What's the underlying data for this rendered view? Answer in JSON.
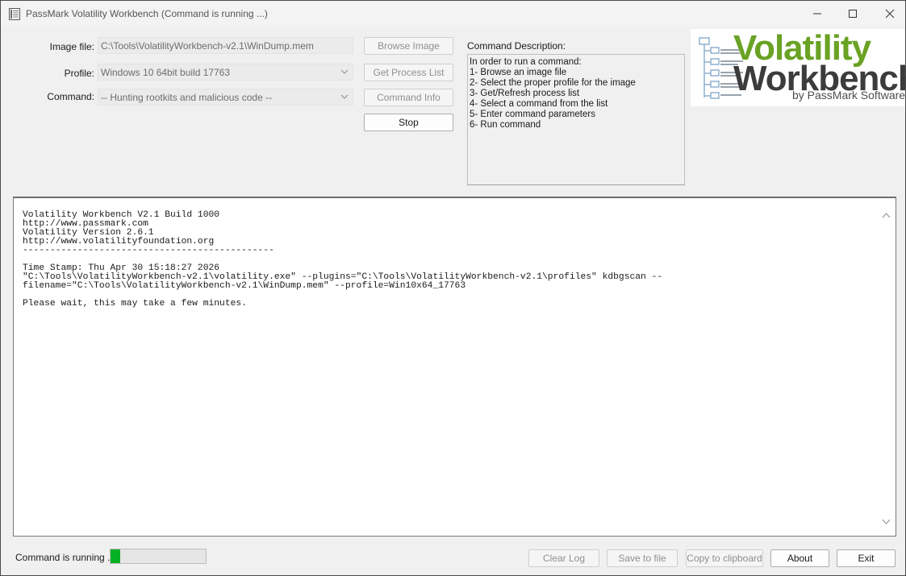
{
  "window": {
    "title": "PassMark Volatility Workbench (Command is running ...)"
  },
  "form": {
    "image_file_label": "Image file:",
    "image_file_value": "C:\\Tools\\VolatilityWorkbench-v2.1\\WinDump.mem",
    "profile_label": "Profile:",
    "profile_value": "Windows 10 64bit build 17763",
    "command_label": "Command:",
    "command_value": "-- Hunting rootkits and malicious code --"
  },
  "buttons": {
    "browse_image": "Browse Image",
    "get_process_list": "Get Process List",
    "command_info": "Command Info",
    "stop": "Stop"
  },
  "command_description": {
    "label": "Command Description:",
    "lines": [
      "In order to run a command:",
      "1- Browse an image file",
      "2- Select the proper profile for the image",
      "3- Get/Refresh process list",
      "4- Select a command from the list",
      "5- Enter command parameters",
      "6- Run command"
    ]
  },
  "logo": {
    "line1": "Volatility",
    "line2": "Workbench",
    "byline": "by PassMark Software"
  },
  "log": {
    "lines": [
      "Volatility Workbench V2.1 Build 1000",
      "http://www.passmark.com",
      "Volatility Version 2.6.1",
      "http://www.volatilityfoundation.org",
      "----------------------------------------------",
      "",
      "Time Stamp: Thu Apr 30 15:18:27 2026",
      "\"C:\\Tools\\VolatilityWorkbench-v2.1\\volatility.exe\" --plugins=\"C:\\Tools\\VolatilityWorkbench-v2.1\\profiles\" kdbgscan --",
      "filename=\"C:\\Tools\\VolatilityWorkbench-v2.1\\WinDump.mem\" --profile=Win10x64_17763",
      "",
      "Please wait, this may take a few minutes."
    ]
  },
  "status": {
    "text": "Command is running ...",
    "progress": 0.1
  },
  "footer_buttons": {
    "clear_log": "Clear Log",
    "save_to_file": "Save to file",
    "copy_to_clipboard": "Copy to clipboard",
    "about": "About",
    "exit": "Exit"
  },
  "colors": {
    "logo_green": "#6aa224",
    "logo_dark": "#3c3c3c",
    "progress_green": "#06b025"
  }
}
